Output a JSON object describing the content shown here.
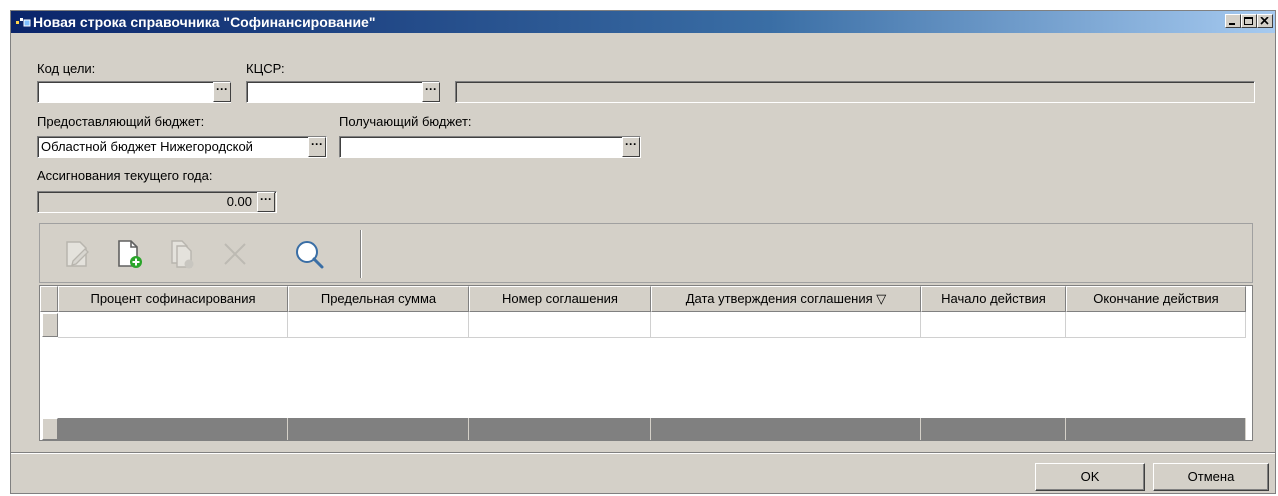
{
  "window": {
    "title": "Новая строка справочника \"Софинансирование\""
  },
  "form": {
    "goal_code_label": "Код цели:",
    "goal_code_value": "",
    "kcsr_label": "КЦСР:",
    "kcsr_value": "",
    "kcsr_name_value": "",
    "providing_budget_label": "Предоставляющий бюджет:",
    "providing_budget_value": "Областной бюджет Нижегородской",
    "receiving_budget_label": "Получающий бюджет:",
    "receiving_budget_value": "",
    "appropriations_label": "Ассигнования текущего года:",
    "appropriations_value": "0.00",
    "lookup_glyph": "···"
  },
  "toolbar": {
    "icons": [
      "edit-icon",
      "new-document-icon",
      "copy-document-icon",
      "delete-icon",
      "search-icon"
    ]
  },
  "grid": {
    "columns": [
      "Процент софинасирования",
      "Предельная сумма",
      "Номер соглашения",
      "Дата утверждения соглашения ▽",
      "Начало действия",
      "Окончание действия"
    ]
  },
  "buttons": {
    "ok": "OK",
    "cancel": "Отмена"
  },
  "colors": {
    "window_bg": "#d4d0c8",
    "title_start": "#0a246a",
    "title_end": "#a6caf0"
  }
}
